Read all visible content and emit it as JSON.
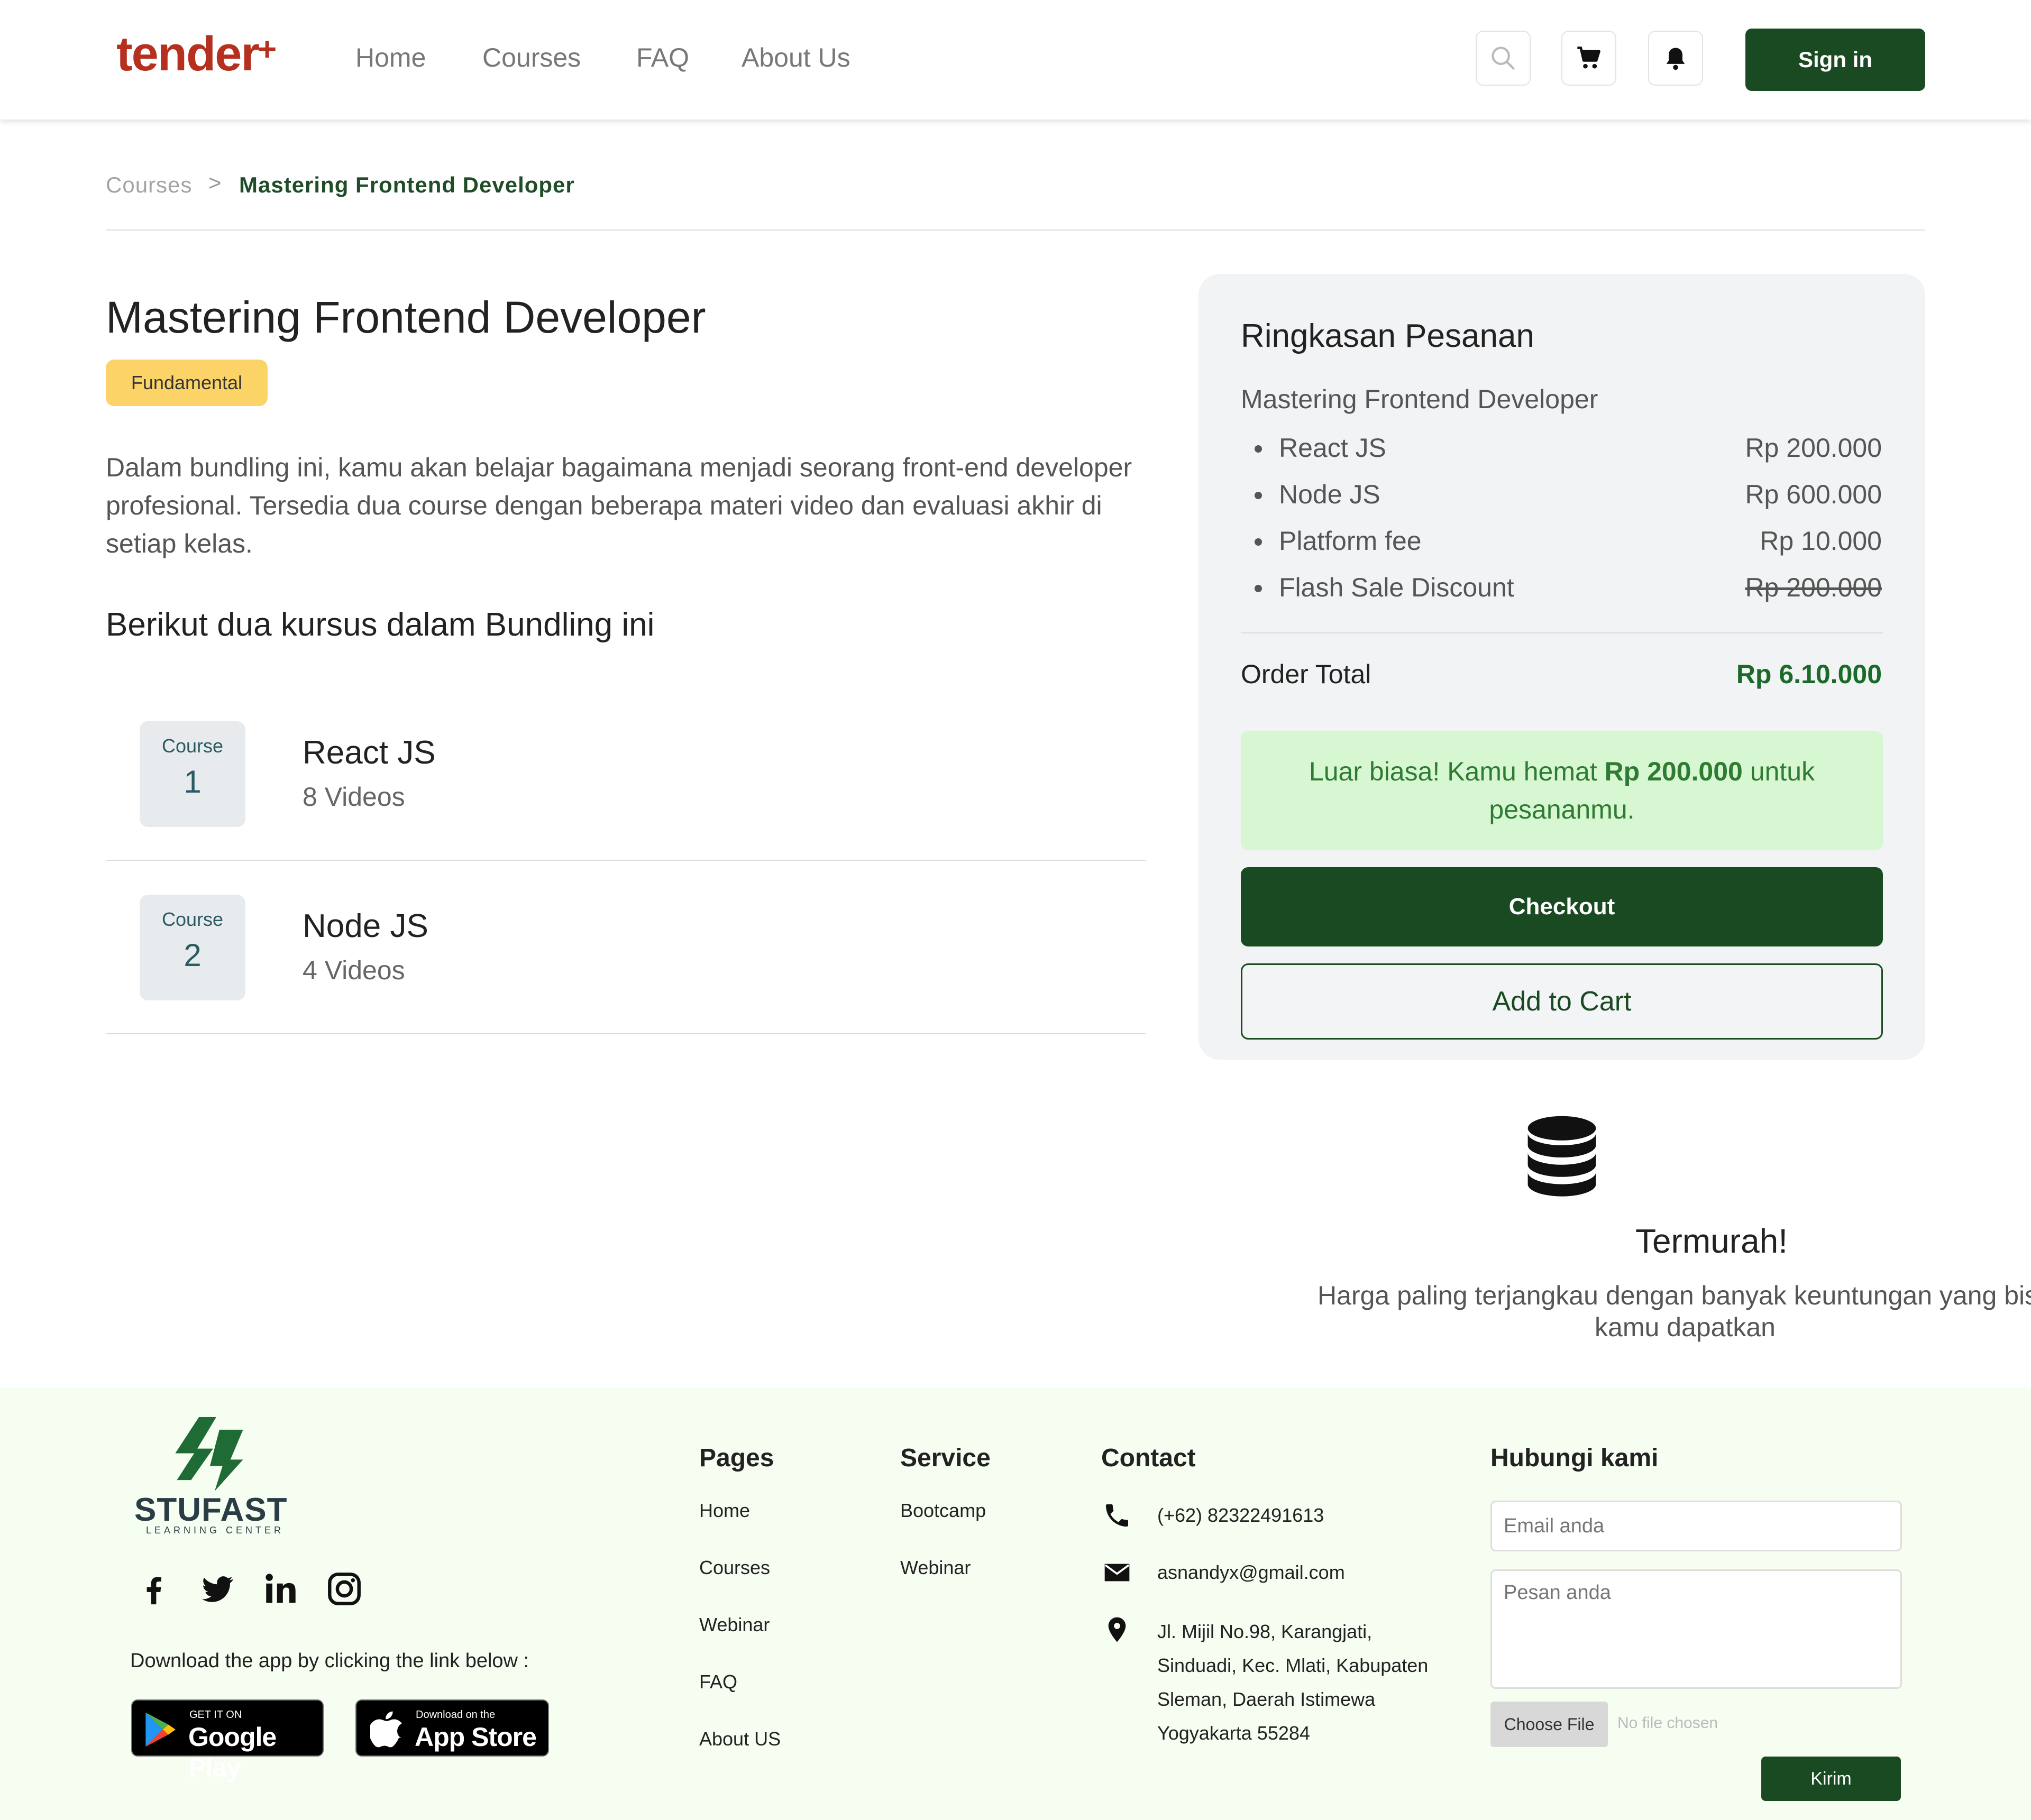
{
  "brand": {
    "name": "tender",
    "plus": "+",
    "color": "#b5301f"
  },
  "nav": {
    "links": [
      "Home",
      "Courses",
      "FAQ",
      "About Us"
    ],
    "signin_label": "Sign in"
  },
  "header_icons": [
    "search-icon",
    "cart-icon",
    "bell-icon"
  ],
  "breadcrumb": {
    "root": "Courses",
    "separator": ">",
    "current": "Mastering Frontend Developer"
  },
  "course": {
    "title": "Mastering Frontend Developer",
    "badge": "Fundamental",
    "description": "Dalam bundling ini, kamu akan belajar bagaimana menjadi seorang front-end developer profesional. Tersedia dua course dengan beberapa materi video dan evaluasi akhir di setiap kelas.",
    "subtitle": "Berikut dua kursus dalam Bundling ini",
    "items": [
      {
        "label": "Course",
        "number": "1",
        "name": "React JS",
        "count": "8 Videos"
      },
      {
        "label": "Course",
        "number": "2",
        "name": "Node JS",
        "count": "4 Videos"
      }
    ]
  },
  "summary": {
    "title": "Ringkasan Pesanan",
    "subtitle": "Mastering Frontend Developer",
    "items": [
      {
        "name": "React JS",
        "price": "Rp 200.000",
        "strike": false
      },
      {
        "name": "Node JS",
        "price": "Rp 600.000",
        "strike": false
      },
      {
        "name": "Platform fee",
        "price": "Rp 10.000",
        "strike": false
      },
      {
        "name": "Flash Sale Discount",
        "price": "Rp 200.000",
        "strike": true
      }
    ],
    "total_label": "Order Total",
    "total_value": "Rp 6.10.000",
    "savings_prefix": "Luar biasa! Kamu hemat ",
    "savings_amount": "Rp 200.000",
    "savings_suffix": " untuk pesananmu.",
    "checkout_label": "Checkout",
    "cart_label": "Add to Cart"
  },
  "feature": {
    "icon": "database-icon",
    "title": "Termurah!",
    "description": "Harga paling terjangkau dengan banyak keuntungan yang bisa kamu dapatkan"
  },
  "footer": {
    "logo_name": "STUFAST",
    "logo_tagline": "LEARNING CENTER",
    "social": [
      "facebook-icon",
      "twitter-icon",
      "linkedin-icon",
      "instagram-icon"
    ],
    "download_text": "Download the app by clicking the link below :",
    "google_play": {
      "small": "GET IT ON",
      "big": "Google Play"
    },
    "app_store": {
      "small": "Download on the",
      "big": "App Store"
    },
    "pages": {
      "heading": "Pages",
      "links": [
        "Home",
        "Courses",
        "Webinar",
        "FAQ",
        "About US"
      ]
    },
    "service": {
      "heading": "Service",
      "links": [
        "Bootcamp",
        "Webinar"
      ]
    },
    "contact": {
      "heading": "Contact",
      "phone": "(+62) 82322491613",
      "email": "asnandyx@gmail.com",
      "address_lines": [
        "Jl. Mijil No.98, Karangjati,",
        "Sinduadi, Kec. Mlati, Kabupaten",
        "Sleman, Daerah Istimewa",
        "Yogyakarta 55284"
      ]
    },
    "hubungi": {
      "heading": "Hubungi kami",
      "email_placeholder": "Email anda",
      "message_placeholder": "Pesan anda",
      "file_button": "Choose File",
      "file_status": "No file chosen",
      "submit_label": "Kirim"
    }
  },
  "colors": {
    "primary": "#1a4a22",
    "accent_yellow": "#fcd366",
    "success_bg": "#d7f7d2",
    "footer_bg": "#f6fdf1"
  }
}
